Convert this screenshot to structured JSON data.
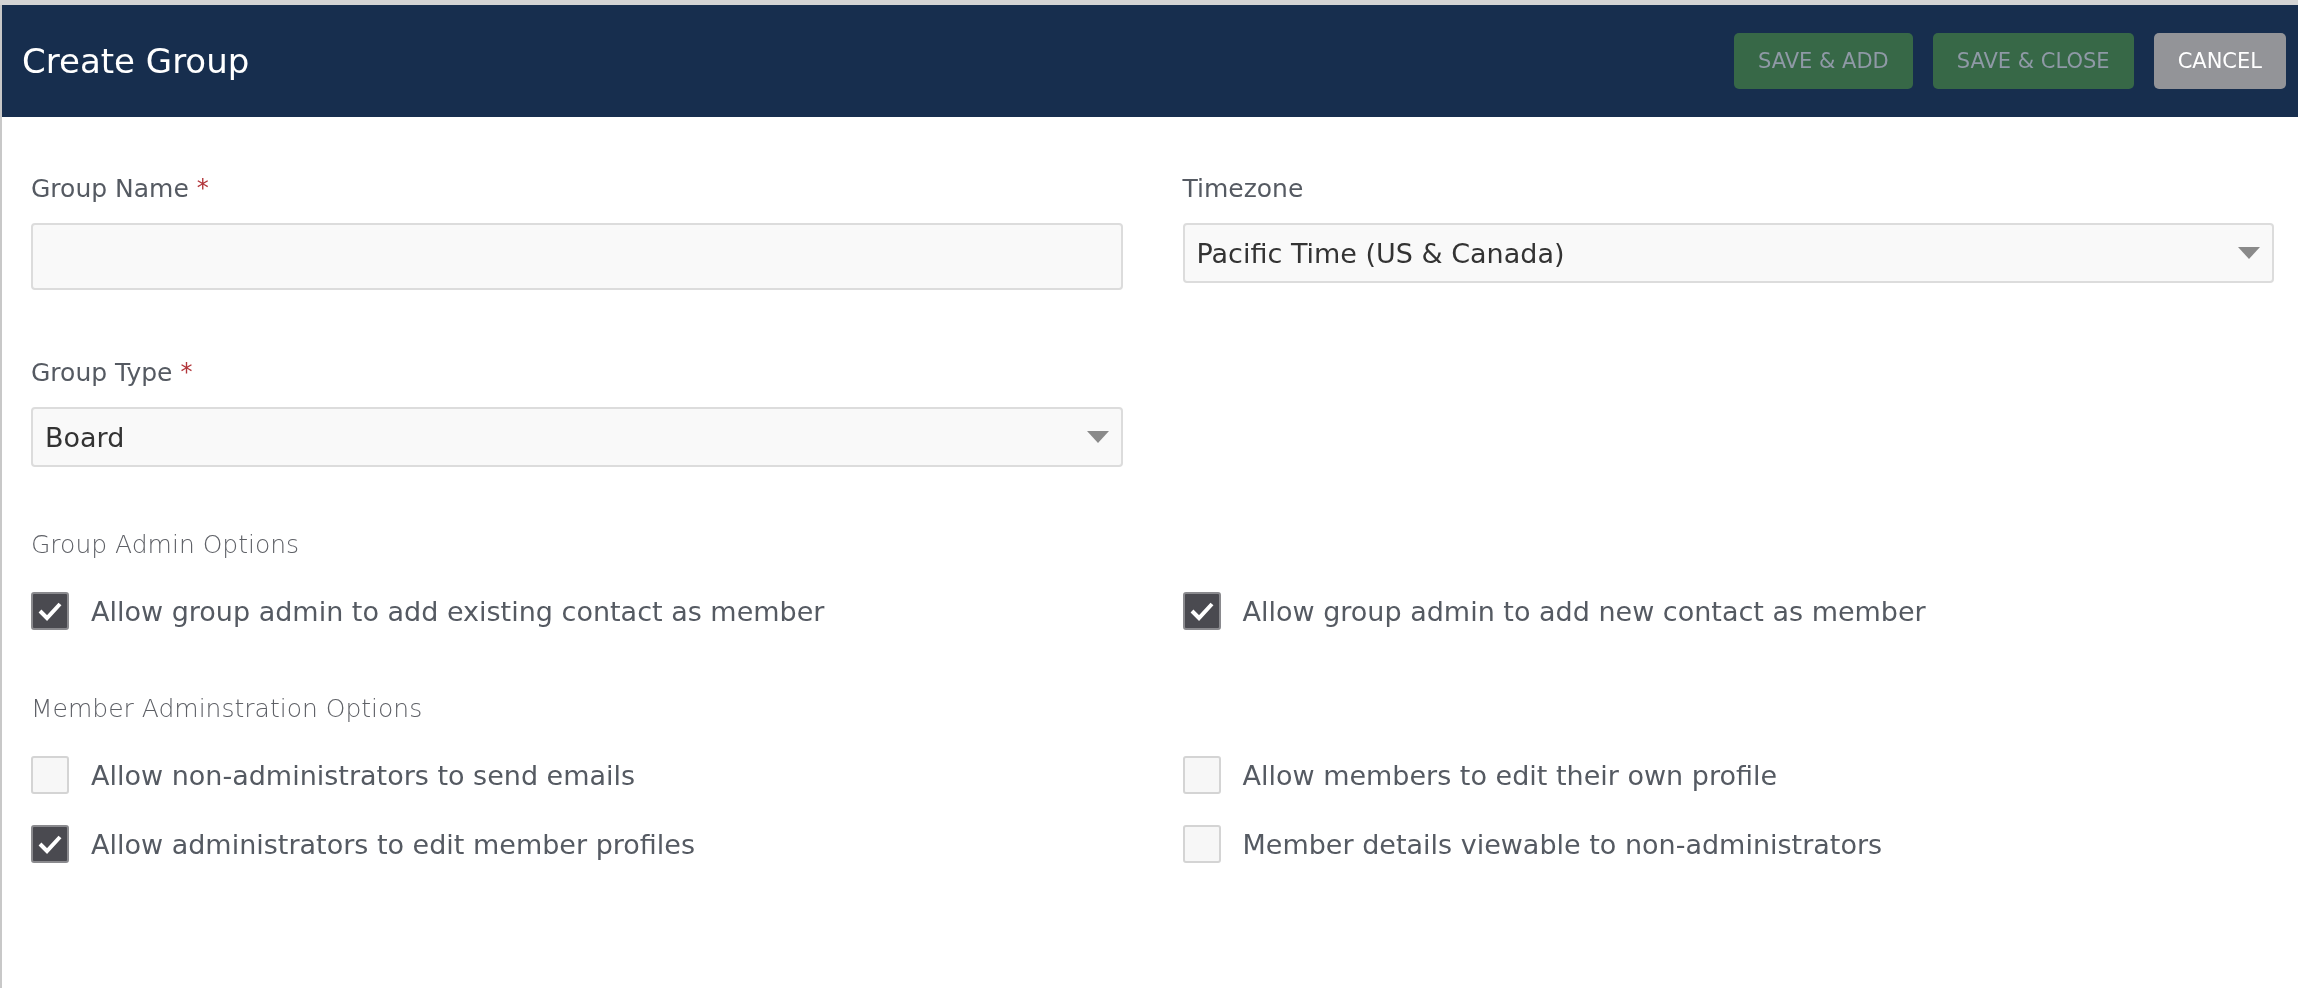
{
  "header": {
    "title": "Create Group",
    "buttons": [
      {
        "label": "SAVE & ADD",
        "kind": "save",
        "disabled": true
      },
      {
        "label": "SAVE & CLOSE",
        "kind": "save",
        "disabled": true
      },
      {
        "label": "CANCEL",
        "kind": "cancel",
        "disabled": false
      }
    ]
  },
  "fields": [
    {
      "label": "Group Name",
      "required_mark": "*",
      "kind": "text"
    },
    {
      "label": "Timezone",
      "kind": "select",
      "value": "Pacific Time (US & Canada)"
    },
    {
      "label": "Group Type",
      "required_mark": "*",
      "kind": "select",
      "value": "Board"
    }
  ],
  "sections": [
    {
      "title": "Group Admin Options",
      "options": [
        {
          "label": "Allow group admin to add existing contact as member",
          "checked": true
        },
        {
          "label": "Allow group admin to add new contact as member",
          "checked": true
        }
      ]
    },
    {
      "title": "Member Adminstration Options",
      "options": [
        {
          "label": "Allow non-administrators to send emails",
          "checked": false
        },
        {
          "label": "Allow members to edit their own profile",
          "checked": false
        },
        {
          "label": "Allow administrators to edit member profiles",
          "checked": true
        },
        {
          "label": "Member details viewable to non-administrators",
          "checked": false
        }
      ]
    }
  ]
}
